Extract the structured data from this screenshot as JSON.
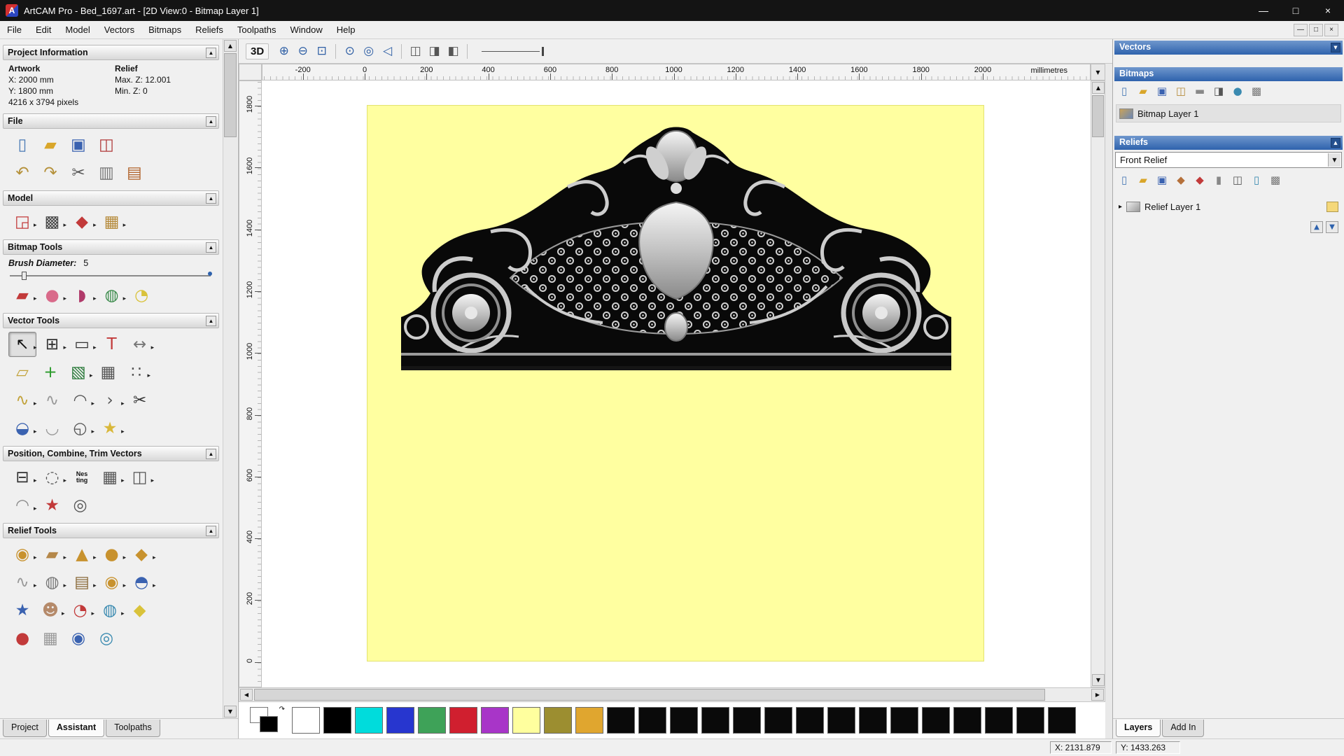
{
  "window": {
    "logo_letter": "A",
    "title": "ArtCAM Pro - Bed_1697.art - [2D View:0 - Bitmap Layer 1]"
  },
  "glyphs": {
    "minimize": "—",
    "maximize": "□",
    "close": "×",
    "collapse": "▲",
    "dropdown": "▼",
    "up": "▲",
    "down": "▼",
    "left": "◀",
    "right": "▶",
    "expander": "▸",
    "swap": "↷"
  },
  "menubar": {
    "items": [
      "File",
      "Edit",
      "Model",
      "Vectors",
      "Bitmaps",
      "Reliefs",
      "Toolpaths",
      "Window",
      "Help"
    ]
  },
  "main_toolbar": {
    "view_button": "3D",
    "buttons": [
      {
        "n": "zoom-in-icon",
        "g": "⊕",
        "c": "#2f5fa5"
      },
      {
        "n": "zoom-out-icon",
        "g": "⊖",
        "c": "#2f5fa5"
      },
      {
        "n": "zoom-window-icon",
        "g": "⊡",
        "c": "#2f5fa5"
      },
      {
        "sep": 1
      },
      {
        "n": "zoom-extents-icon",
        "g": "⊙",
        "c": "#2f5fa5"
      },
      {
        "n": "zoom-100-icon",
        "g": "◎",
        "c": "#2f5fa5"
      },
      {
        "n": "zoom-previous-icon",
        "g": "◁",
        "c": "#2f5fa5"
      },
      {
        "sep": 1
      },
      {
        "n": "pan-view-icon",
        "g": "◫",
        "c": "#555555"
      },
      {
        "n": "refresh-view-icon",
        "g": "◨",
        "c": "#555555"
      },
      {
        "n": "preview-relief-icon",
        "g": "◧",
        "c": "#555555"
      },
      {
        "sep": 1
      }
    ]
  },
  "ruler": {
    "unit": "millimetres",
    "top_ticks": [
      -200,
      0,
      200,
      400,
      600,
      800,
      1000,
      1200,
      1400,
      1600,
      1800,
      2000
    ],
    "left_ticks": [
      1800,
      1600,
      1400,
      1200,
      1000,
      800,
      600,
      400,
      200,
      0
    ]
  },
  "left_panel": {
    "sections": {
      "project_information": "Project Information",
      "file": "File",
      "model": "Model",
      "bitmap_tools": "Bitmap Tools",
      "vector_tools": "Vector Tools",
      "position_combine": "Position, Combine, Trim Vectors",
      "relief_tools": "Relief Tools"
    },
    "info": {
      "col1": "Artwork",
      "col2": "Relief",
      "x": "X: 2000 mm",
      "maxz": "Max. Z: 12.001",
      "y": "Y: 1800 mm",
      "minz": "Min. Z: 0",
      "pixels": "4216 x 3794 pixels"
    },
    "brush": {
      "label": "Brush Diameter:",
      "value": "5"
    },
    "icons": {
      "file": [
        [
          {
            "n": "new-model-icon",
            "g": "▯",
            "c": "#4a7ab5"
          },
          {
            "n": "open-model-icon",
            "g": "▰",
            "c": "#d9a62a"
          },
          {
            "n": "save-model-icon",
            "g": "▣",
            "c": "#3a62b0"
          },
          {
            "n": "export-model-icon",
            "g": "◫",
            "c": "#b03a3a"
          }
        ],
        [
          {
            "n": "undo-icon",
            "g": "↶",
            "c": "#b5913a"
          },
          {
            "n": "redo-icon",
            "g": "↷",
            "c": "#b5913a"
          },
          {
            "n": "cut-icon",
            "g": "✂",
            "c": "#555555"
          },
          {
            "n": "copy-icon",
            "g": "▥",
            "c": "#777777"
          },
          {
            "n": "paste-icon",
            "g": "▤",
            "c": "#b0622a"
          }
        ]
      ],
      "model": [
        [
          {
            "n": "set-model-size-icon",
            "g": "◲",
            "c": "#c23a3a",
            "f": 1
          },
          {
            "n": "model-preview-icon",
            "g": "▩",
            "c": "#444444",
            "f": 1
          },
          {
            "n": "adjust-model-icon",
            "g": "◆",
            "c": "#c23a3a",
            "f": 1
          },
          {
            "n": "load-bitmap-icon",
            "g": "▦",
            "c": "#b58a3a",
            "f": 1
          }
        ]
      ],
      "paint": [
        [
          {
            "n": "paint-brush-icon",
            "g": "▰",
            "c": "#c23a3a",
            "f": 1
          },
          {
            "n": "flood-fill-icon",
            "g": "●",
            "c": "#d96a8a",
            "f": 1
          },
          {
            "n": "colour-picker-icon",
            "g": "◗",
            "c": "#b03a6a",
            "f": 1
          },
          {
            "n": "colour-palette-icon",
            "g": "◍",
            "c": "#3a8a4a",
            "f": 1
          },
          {
            "n": "fill-bucket-icon",
            "g": "◔",
            "c": "#d9c23a"
          }
        ]
      ],
      "vector": [
        [
          {
            "n": "select-vectors-icon",
            "g": "↖",
            "c": "#111111",
            "p": 1,
            "f": 1
          },
          {
            "n": "transform-vectors-icon",
            "g": "⊞",
            "c": "#333333",
            "f": 1
          },
          {
            "n": "rectangle-tool-icon",
            "g": "▭",
            "c": "#333333",
            "f": 1
          },
          {
            "n": "text-tool-icon",
            "g": "T",
            "c": "#c23a3a"
          },
          {
            "n": "measure-tool-icon",
            "g": "↔",
            "c": "#777777",
            "f": 1
          }
        ],
        [
          {
            "n": "envelope-distortion-icon",
            "g": "▱",
            "c": "#c2a23a"
          },
          {
            "n": "node-editing-icon",
            "g": "+",
            "c": "#2a9a2a"
          },
          {
            "n": "text-block-icon",
            "g": "▧",
            "c": "#2a7a3a",
            "f": 1
          },
          {
            "n": "vector-grid-icon",
            "g": "▦",
            "c": "#555555"
          },
          {
            "n": "array-copy-icon",
            "g": "∷",
            "c": "#555555",
            "f": 1
          }
        ],
        [
          {
            "n": "create-polyline-icon",
            "g": "∿",
            "c": "#c2a23a",
            "f": 1
          },
          {
            "n": "smooth-polyline-icon",
            "g": "∿",
            "c": "#999999"
          },
          {
            "n": "bezier-curve-icon",
            "g": "◠",
            "c": "#555555",
            "f": 1
          },
          {
            "n": "arc-tool-icon",
            "g": "›",
            "c": "#555555",
            "f": 1
          },
          {
            "n": "trim-vectors-icon",
            "g": "✂",
            "c": "#333333"
          }
        ],
        [
          {
            "n": "ellipse-tool-icon",
            "g": "◒",
            "c": "#3a62b0",
            "f": 1
          },
          {
            "n": "offset-vectors-icon",
            "g": "◡",
            "c": "#999999"
          },
          {
            "n": "dimension-tool-icon",
            "g": "◵",
            "c": "#555555",
            "f": 1
          },
          {
            "n": "star-tool-icon",
            "g": "★",
            "c": "#d9b83a",
            "f": 1
          }
        ]
      ],
      "position": [
        [
          {
            "n": "align-vectors-icon",
            "g": "⊟",
            "c": "#333333",
            "f": 1
          },
          {
            "n": "block-circular-copy-icon",
            "g": "◌",
            "c": "#555555",
            "f": 1
          },
          {
            "n": "nesting-icon",
            "t": "Nes ting"
          },
          {
            "n": "block-copy-icon",
            "g": "▦",
            "c": "#555555",
            "f": 1
          },
          {
            "n": "copy-along-curve-icon",
            "g": "◫",
            "c": "#555555",
            "f": 1
          }
        ],
        [
          {
            "n": "mirror-vectors-icon",
            "g": "◠",
            "c": "#8a8a8a",
            "f": 1
          },
          {
            "n": "weld-vectors-icon",
            "g": "★",
            "c": "#c23a3a"
          },
          {
            "n": "spiral-tool-icon",
            "g": "◎",
            "c": "#555555"
          }
        ]
      ],
      "relief": [
        [
          {
            "n": "texture-relief-icon",
            "g": "◉",
            "c": "#c8922e",
            "f": 1
          },
          {
            "n": "smooth-relief-icon",
            "g": "▰",
            "c": "#b5884a",
            "f": 1
          },
          {
            "n": "sculpt-relief-icon",
            "g": "▲",
            "c": "#c8922e",
            "f": 1
          },
          {
            "n": "shape-editor-icon",
            "g": "●",
            "c": "#c8922e",
            "f": 1
          },
          {
            "n": "two-rail-sweep-icon",
            "g": "◆",
            "c": "#c8922e",
            "f": 1
          }
        ],
        [
          {
            "n": "extrude-relief-icon",
            "g": "∿",
            "c": "#999999",
            "f": 1
          },
          {
            "n": "weave-wizard-icon",
            "g": "◍",
            "c": "#777777",
            "f": 1
          },
          {
            "n": "relief-library-icon",
            "g": "▤",
            "c": "#8a6a3a",
            "f": 1
          },
          {
            "n": "turn-model-icon",
            "g": "◉",
            "c": "#c8922e",
            "f": 1
          },
          {
            "n": "iso-form-icon",
            "g": "◓",
            "c": "#3a62b0",
            "f": 1
          }
        ],
        [
          {
            "n": "star-relief-icon",
            "g": "★",
            "c": "#3a62b0"
          },
          {
            "n": "face-wizard-icon",
            "g": "☻",
            "c": "#b58a6a",
            "f": 1
          },
          {
            "n": "texture-flow-icon",
            "g": "◔",
            "c": "#c23a3a",
            "f": 1
          },
          {
            "n": "dome-relief-icon",
            "g": "◍",
            "c": "#3a8ab0",
            "f": 1
          },
          {
            "n": "add-draft-icon",
            "g": "◆",
            "c": "#d9c23a"
          }
        ],
        [
          {
            "n": "interactive-sculpt-icon",
            "g": "●",
            "c": "#c23a3a"
          },
          {
            "n": "mesh-relief-icon",
            "g": "▦",
            "c": "#999999"
          },
          {
            "n": "sphere-relief-icon",
            "g": "◉",
            "c": "#3a62b0"
          },
          {
            "n": "swirl-relief-icon",
            "g": "◎",
            "c": "#3a8ab0"
          }
        ]
      ]
    },
    "tabs": [
      {
        "label": "Project"
      },
      {
        "label": "Assistant",
        "active": true
      },
      {
        "label": "Toolpaths"
      }
    ]
  },
  "right_panel": {
    "vectors": {
      "title": "Vectors"
    },
    "bitmaps": {
      "title": "Bitmaps",
      "toolbar": [
        {
          "n": "bitmap-new-icon",
          "g": "▯",
          "c": "#4a7ab5"
        },
        {
          "n": "bitmap-open-icon",
          "g": "▰",
          "c": "#d9a62a"
        },
        {
          "n": "bitmap-save-icon",
          "g": "▣",
          "c": "#3a62b0"
        },
        {
          "n": "bitmap-merge-icon",
          "g": "◫",
          "c": "#b58a3a"
        },
        {
          "n": "bitmap-slice-icon",
          "g": "▬",
          "c": "#888888"
        },
        {
          "n": "bitmap-link-icon",
          "g": "◨",
          "c": "#555555"
        },
        {
          "n": "bitmap-colour-icon",
          "g": "●",
          "c": "#3a8ab0"
        },
        {
          "n": "bitmap-options-icon",
          "g": "▩",
          "c": "#777777"
        }
      ],
      "layer_label": "Bitmap Layer 1"
    },
    "reliefs": {
      "title": "Reliefs",
      "combo_value": "Front Relief",
      "toolbar": [
        {
          "n": "relief-new-icon",
          "g": "▯",
          "c": "#4a7ab5"
        },
        {
          "n": "relief-open-icon",
          "g": "▰",
          "c": "#d9a62a"
        },
        {
          "n": "relief-save-icon",
          "g": "▣",
          "c": "#3a62b0"
        },
        {
          "n": "relief-import-icon",
          "g": "◆",
          "c": "#b5703a"
        },
        {
          "n": "relief-merge-icon",
          "g": "◆",
          "c": "#c23a3a"
        },
        {
          "n": "relief-scale-icon",
          "g": "▮",
          "c": "#888888"
        },
        {
          "n": "relief-invert-icon",
          "g": "◫",
          "c": "#555555"
        },
        {
          "n": "relief-delete-icon",
          "g": "▯",
          "c": "#3a8ab0"
        },
        {
          "n": "relief-options-icon",
          "g": "▩",
          "c": "#777777"
        }
      ],
      "layer_label": "Relief Layer 1"
    },
    "tabs": [
      {
        "label": "Layers",
        "active": true
      },
      {
        "label": "Add In"
      }
    ]
  },
  "palette": {
    "dual": {
      "fg": "#ffffff",
      "bg": "#000000"
    },
    "colors": [
      {
        "name": "white",
        "hex": "#ffffff"
      },
      {
        "name": "black",
        "hex": "#000000"
      },
      {
        "name": "cyan",
        "hex": "#00dcdc"
      },
      {
        "name": "blue",
        "hex": "#2736cf"
      },
      {
        "name": "green",
        "hex": "#3ea258"
      },
      {
        "name": "red",
        "hex": "#d01f2f"
      },
      {
        "name": "magenta",
        "hex": "#a835c8"
      },
      {
        "name": "pale-yellow",
        "hex": "#ffff9e"
      },
      {
        "name": "olive",
        "hex": "#9c8e30"
      },
      {
        "name": "gold",
        "hex": "#e0a62f"
      },
      {
        "name": "black-2",
        "hex": "#0a0a0a"
      },
      {
        "name": "black-3",
        "hex": "#0a0a0a"
      },
      {
        "name": "black-4",
        "hex": "#0a0a0a"
      },
      {
        "name": "black-5",
        "hex": "#0a0a0a"
      },
      {
        "name": "black-6",
        "hex": "#0a0a0a"
      },
      {
        "name": "black-7",
        "hex": "#0a0a0a"
      },
      {
        "name": "black-8",
        "hex": "#0a0a0a"
      },
      {
        "name": "black-9",
        "hex": "#0a0a0a"
      },
      {
        "name": "black-10",
        "hex": "#0a0a0a"
      },
      {
        "name": "black-11",
        "hex": "#0a0a0a"
      },
      {
        "name": "black-12",
        "hex": "#0a0a0a"
      },
      {
        "name": "black-13",
        "hex": "#0a0a0a"
      },
      {
        "name": "black-14",
        "hex": "#0a0a0a"
      },
      {
        "name": "black-15",
        "hex": "#0a0a0a"
      },
      {
        "name": "black-16",
        "hex": "#0a0a0a"
      }
    ]
  },
  "status": {
    "x": "X: 2131.879",
    "y": "Y: 1433.263"
  }
}
